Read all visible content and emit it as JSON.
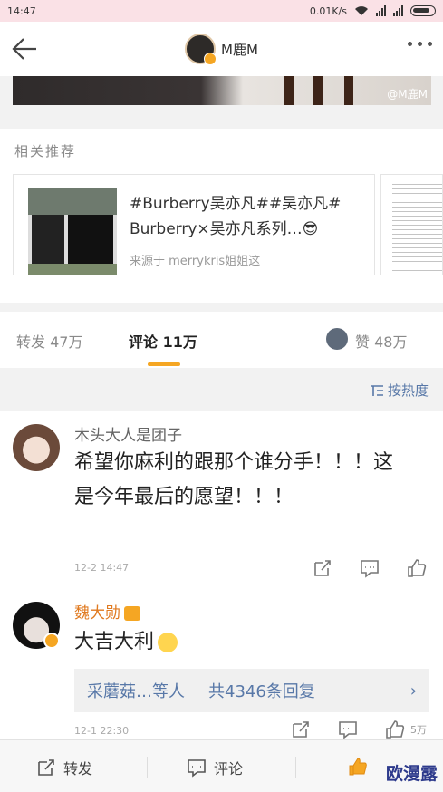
{
  "status_bar": {
    "time": "14:47",
    "network_speed": "0.01K/s"
  },
  "nav": {
    "title": "M鹿M"
  },
  "post_image": {
    "watermark": "@M鹿M"
  },
  "related": {
    "title": "相关推荐",
    "card": {
      "text": "#Burberry吴亦凡##吴亦凡# Burberry×吴亦凡系列…😎",
      "source": "来源于 merrykris姐姐这"
    }
  },
  "tabs": {
    "repost": "转发 47万",
    "comment": "评论 11万",
    "like": "赞 48万"
  },
  "sort": {
    "label": "按热度"
  },
  "comments": [
    {
      "name": "木头大人是团子",
      "text": "希望你麻利的跟那个谁分手！！！这是今年最后的愿望！！！",
      "time": "12-2 14:47"
    },
    {
      "name": "魏大勋",
      "text": "大吉大利",
      "reply_prefix": "采蘑菇…等人",
      "reply_count": "共4346条回复",
      "time": "12-1 22:30",
      "like_count": "5万"
    }
  ],
  "bottom_bar": {
    "repost": "转发",
    "comment": "评论",
    "watermark": "欧漫露"
  },
  "colors": {
    "accent": "#f5a623",
    "link": "#5878a8",
    "status_bg": "#fae1e6"
  }
}
